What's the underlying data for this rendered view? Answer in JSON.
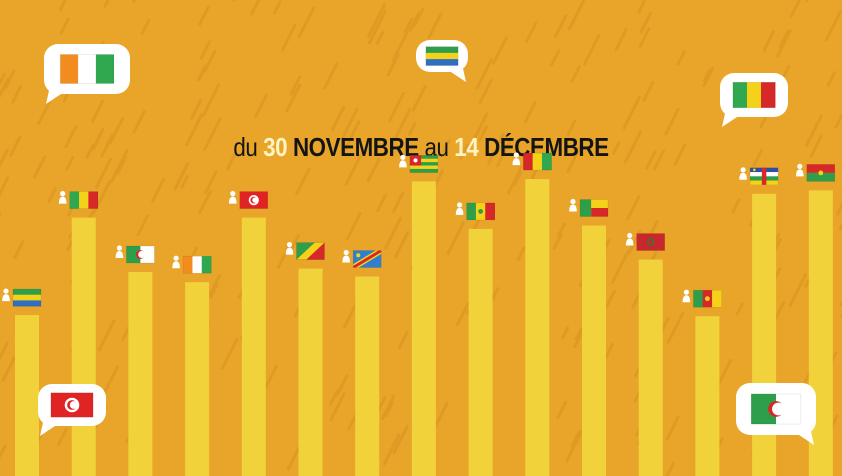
{
  "colors": {
    "background": "#E8A52A",
    "bar": "#F2D23A",
    "bubble": "#FFFFFF",
    "title_text": "#141414",
    "title_number": "#FFF4C2",
    "person_icon": "#FFFFFF"
  },
  "title": {
    "part1": "du ",
    "num1": "30",
    "part2": " NOVEMBRE",
    "part3": " au ",
    "num2": "14",
    "part4": " DÉCEMBRE"
  },
  "icons": {
    "person": "person-icon"
  },
  "chart_data": {
    "type": "bar",
    "categories": [
      "gabon",
      "mali",
      "algeria",
      "cote-divoire",
      "tunisia",
      "congo",
      "dr-congo",
      "togo",
      "senegal",
      "guinea",
      "benin",
      "morocco",
      "cameroon",
      "central-african-republic",
      "burkina-faso"
    ],
    "values": [
      142,
      228,
      180,
      171,
      228,
      183,
      176,
      260,
      218,
      262,
      221,
      191,
      141,
      249,
      252
    ],
    "ylim": [
      0,
      300
    ],
    "grid": false,
    "legend": "none"
  },
  "speech_bubbles": [
    {
      "flag": "cote-divoire"
    },
    {
      "flag": "gabon"
    },
    {
      "flag": "mali"
    },
    {
      "flag": "tunisia"
    },
    {
      "flag": "algeria"
    }
  ]
}
